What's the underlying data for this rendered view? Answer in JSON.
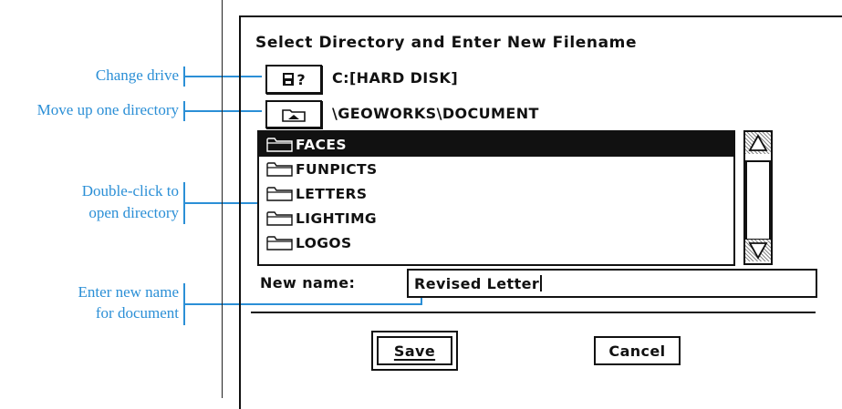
{
  "callouts": [
    {
      "lines": [
        "Change drive"
      ]
    },
    {
      "lines": [
        "Move up one directory"
      ]
    },
    {
      "lines": [
        "Double-click to",
        "open directory"
      ]
    },
    {
      "lines": [
        "Enter new name",
        "for document"
      ]
    }
  ],
  "dialog": {
    "title": "Select Directory and Enter New Filename",
    "drive_button_label": "?",
    "drive_label": "C:[HARD DISK]",
    "path": "\\GEOWORKS\\DOCUMENT",
    "directories": [
      "FACES",
      "FUNPICTS",
      "LETTERS",
      "LIGHTIMG",
      "LOGOS"
    ],
    "selected_index": 0,
    "new_name_label": "New name:",
    "new_name_value": "Revised Letter",
    "save_label": "Save",
    "cancel_label": "Cancel"
  },
  "colors": {
    "callout": "#2b8fd6",
    "selection": "#111111"
  },
  "icons": [
    "drive-icon",
    "up-directory-icon",
    "folder-icon",
    "scroll-up-icon",
    "scroll-down-icon"
  ]
}
